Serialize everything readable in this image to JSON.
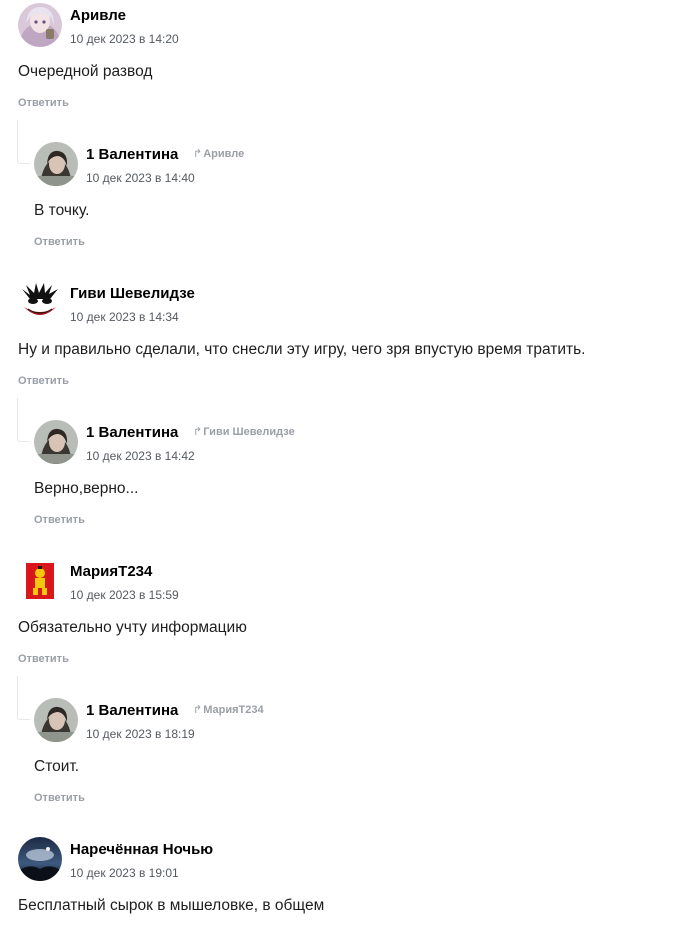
{
  "reply_label": "Ответить",
  "reply_arrow_icon": "reply-arrow-icon",
  "comments": [
    {
      "author": "Аривле",
      "date": "10 дек 2023 в 14:20",
      "text": "Очередной развод",
      "avatar_icon": "anime-girl-avatar"
    },
    {
      "author": "1 Валентина",
      "reply_to": "Аривле",
      "date": "10 дек 2023 в 14:40",
      "text": "В точку.",
      "avatar_icon": "woman-photo-avatar"
    },
    {
      "author": "Гиви Шевелидзе",
      "date": "10 дек 2023 в 14:34",
      "text": "Ну и правильно сделали, что снесли эту игру, чего зря впустую время тратить.",
      "avatar_icon": "joker-avatar"
    },
    {
      "author": "1 Валентина",
      "reply_to": "Гиви Шевелидзе",
      "date": "10 дек 2023 в 14:42",
      "text": "Верно,верно...",
      "avatar_icon": "woman-photo-avatar"
    },
    {
      "author": "МарияТ234",
      "date": "10 дек 2023 в 15:59",
      "text": "Обязательно учту информацию",
      "avatar_icon": "cartoon-character-avatar"
    },
    {
      "author": "1 Валентина",
      "reply_to": "МарияТ234",
      "date": "10 дек 2023 в 18:19",
      "text": "Стоит.",
      "avatar_icon": "woman-photo-avatar"
    },
    {
      "author": "Наречённая Ночью",
      "date": "10 дек 2023 в 19:01",
      "text": "Бесплатный сырок в мышеловке, в общем",
      "avatar_icon": "night-sky-avatar"
    }
  ]
}
